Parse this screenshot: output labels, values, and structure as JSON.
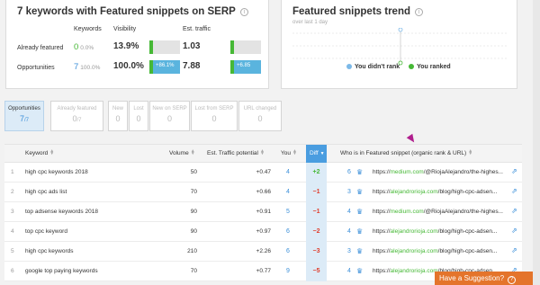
{
  "summary": {
    "title": "7 keywords with Featured snippets on SERP",
    "info_glyph": "i",
    "col_keywords": "Keywords",
    "col_visibility": "Visibility",
    "col_traffic": "Est. traffic",
    "featured": {
      "label": "Already featured",
      "count": "0",
      "percent": "0.0%",
      "visibility": "13.9%",
      "traffic": "1.03",
      "visibility_bar_fill": 0.139,
      "traffic_bar_fill": 0.139
    },
    "opportunities": {
      "label": "Opportunities",
      "count": "7",
      "percent": "100.0%",
      "visibility": "100.0%",
      "traffic": "7.88",
      "visibility_change": "+86.1%",
      "traffic_change": "+6.85"
    }
  },
  "trend": {
    "title": "Featured snippets trend",
    "subtitle": "over last 1 day",
    "legend_not_ranked": "You didn't rank",
    "legend_ranked": "You ranked",
    "color_not_ranked": "#7cb9e8",
    "color_ranked": "#46b836"
  },
  "tabs": [
    {
      "label": "Opportunities",
      "value": "7",
      "suffix": "/7",
      "active": true
    },
    {
      "label": "Already featured",
      "value": "0",
      "suffix": "/7",
      "active": false
    },
    {
      "label": "New",
      "value": "0",
      "active": false
    },
    {
      "label": "Lost",
      "value": "0",
      "active": false
    },
    {
      "label": "New on SERP",
      "value": "0",
      "active": false
    },
    {
      "label": "Lost from SERP",
      "value": "0",
      "active": false
    },
    {
      "label": "URL changed",
      "value": "0",
      "active": false
    }
  ],
  "table": {
    "headers": {
      "keyword": "Keyword",
      "volume": "Volume",
      "traffic": "Est. Traffic potential",
      "you": "You",
      "diff": "Diff",
      "who": "Who is in Featured snippet (organic rank & URL)"
    },
    "rows": [
      {
        "idx": "1",
        "keyword": "high cpc keywords 2018",
        "volume": "50",
        "traffic": "+0.47",
        "you": "4",
        "diff": "+2",
        "rank": "6",
        "domain": "medium.com",
        "path": "/@RiojaAlejandro/the-highes..."
      },
      {
        "idx": "2",
        "keyword": "high cpc ads list",
        "volume": "70",
        "traffic": "+0.66",
        "you": "4",
        "diff": "−1",
        "rank": "3",
        "domain": "alejandrorioja.com",
        "path": "/blog/high-cpc-adsen..."
      },
      {
        "idx": "3",
        "keyword": "top adsense keywords 2018",
        "volume": "90",
        "traffic": "+0.91",
        "you": "5",
        "diff": "−1",
        "rank": "4",
        "domain": "medium.com",
        "path": "/@RiojaAlejandro/the-highes..."
      },
      {
        "idx": "4",
        "keyword": "top cpc keyword",
        "volume": "90",
        "traffic": "+0.97",
        "you": "6",
        "diff": "−2",
        "rank": "4",
        "domain": "alejandrorioja.com",
        "path": "/blog/high-cpc-adsen..."
      },
      {
        "idx": "5",
        "keyword": "high cpc keywords",
        "volume": "210",
        "traffic": "+2.26",
        "you": "6",
        "diff": "−3",
        "rank": "3",
        "domain": "alejandrorioja.com",
        "path": "/blog/high-cpc-adsen..."
      },
      {
        "idx": "6",
        "keyword": "google top paying keywords",
        "volume": "70",
        "traffic": "+0.77",
        "you": "9",
        "diff": "−5",
        "rank": "4",
        "domain": "alejandrorioja.com",
        "path": "/blog/high-cpc-adsen..."
      }
    ]
  },
  "suggestion": {
    "label": "Have a Suggestion?",
    "icon_glyph": "?"
  }
}
